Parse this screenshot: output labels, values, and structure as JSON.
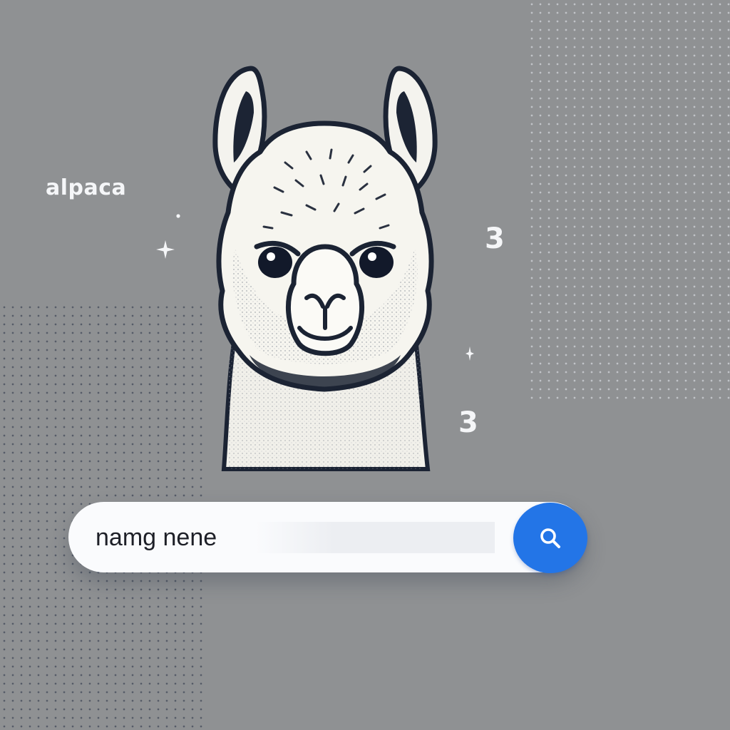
{
  "brand": {
    "label": "alpaca"
  },
  "badges": {
    "top": "3",
    "bottom": "3"
  },
  "hero": {
    "icon": "alpaca-head-illustration"
  },
  "search": {
    "value": "namg nene",
    "button_icon": "search-icon"
  },
  "colors": {
    "background": "#8f9193",
    "search_bar": "#fafbfd",
    "search_button": "#2375e7"
  }
}
